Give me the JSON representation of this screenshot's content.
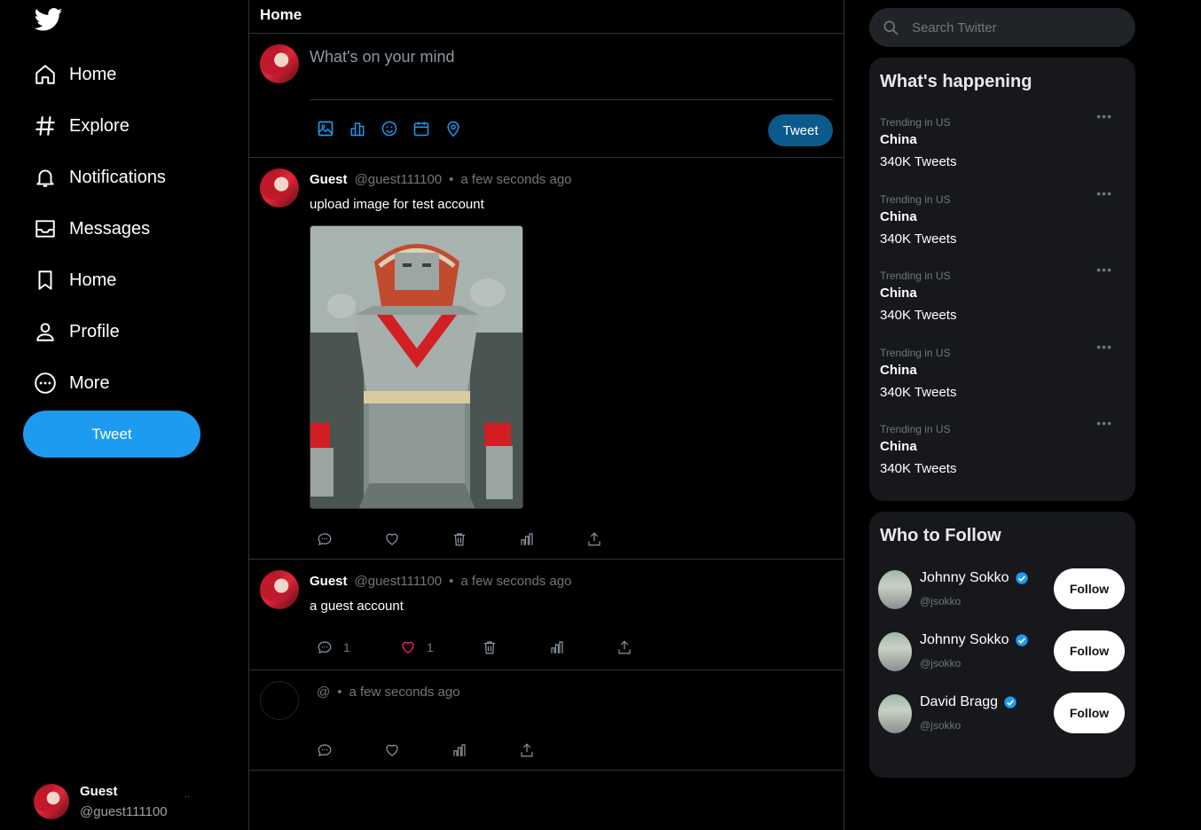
{
  "colors": {
    "accent": "#1d9bf0",
    "like": "#f91880",
    "verified": "#1d9bf0"
  },
  "sidebar": {
    "items": [
      {
        "label": "Home",
        "icon": "home-icon"
      },
      {
        "label": "Explore",
        "icon": "hashtag-icon"
      },
      {
        "label": "Notifications",
        "icon": "bell-icon"
      },
      {
        "label": "Messages",
        "icon": "inbox-icon"
      },
      {
        "label": "Home",
        "icon": "bookmark-icon"
      },
      {
        "label": "Profile",
        "icon": "user-icon"
      },
      {
        "label": "More",
        "icon": "more-circle-icon"
      }
    ],
    "tweet_label": "Tweet",
    "account": {
      "name": "Guest",
      "handle": "@guest111100"
    }
  },
  "main": {
    "title": "Home",
    "composer": {
      "placeholder": "What's on your mind",
      "tweet_label": "Tweet"
    },
    "tweets": [
      {
        "name": "Guest",
        "handle": "@guest111100",
        "time": "a few seconds ago",
        "text": "upload image for test account",
        "has_image": true,
        "reply_count": "",
        "like_count": ""
      },
      {
        "name": "Guest",
        "handle": "@guest111100",
        "time": "a few seconds ago",
        "text": "a guest account",
        "has_image": false,
        "reply_count": "1",
        "like_count": "1",
        "liked": true
      },
      {
        "name": "",
        "handle": "@",
        "time": "a few seconds ago",
        "text": "",
        "has_image": false,
        "reply_count": "",
        "like_count": ""
      }
    ]
  },
  "right": {
    "search": {
      "placeholder": "Search Twitter"
    },
    "trends_title": "What's happening",
    "trends": [
      {
        "context": "Trending in US",
        "topic": "China",
        "count": "340K Tweets"
      },
      {
        "context": "Trending in US",
        "topic": "China",
        "count": "340K Tweets"
      },
      {
        "context": "Trending in US",
        "topic": "China",
        "count": "340K Tweets"
      },
      {
        "context": "Trending in US",
        "topic": "China",
        "count": "340K Tweets"
      },
      {
        "context": "Trending in US",
        "topic": "China",
        "count": "340K Tweets"
      }
    ],
    "follow_title": "Who to Follow",
    "follow": [
      {
        "name": "Johnny Sokko",
        "handle": "@jsokko",
        "button": "Follow",
        "verified": true
      },
      {
        "name": "Johnny Sokko",
        "handle": "@jsokko",
        "button": "Follow",
        "verified": true
      },
      {
        "name": "David Bragg",
        "handle": "@jsokko",
        "button": "Follow",
        "verified": true
      }
    ]
  }
}
